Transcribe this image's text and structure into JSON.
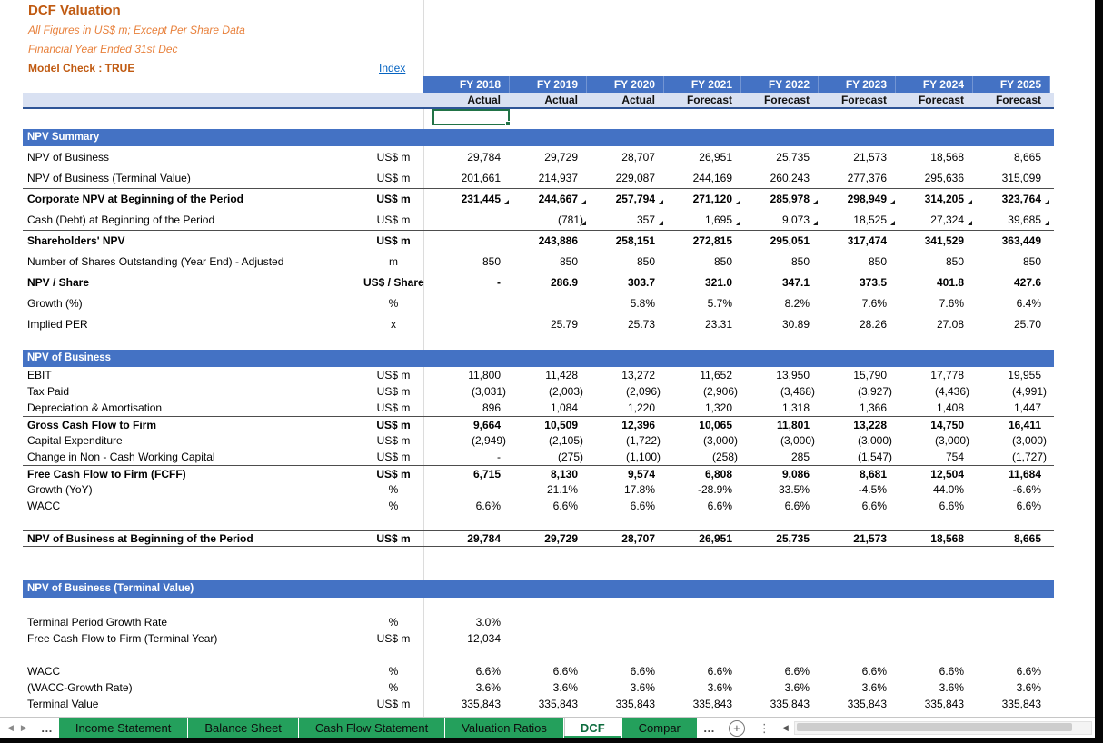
{
  "header": {
    "title": "DCF Valuation",
    "subtitle_units": "All Figures in US$ m; Except Per Share Data",
    "subtitle_fy": "Financial Year Ended 31st Dec",
    "model_check": "Model Check : TRUE",
    "index_link": "Index"
  },
  "columns": [
    {
      "year": "FY 2018",
      "type": "Actual"
    },
    {
      "year": "FY 2019",
      "type": "Actual"
    },
    {
      "year": "FY 2020",
      "type": "Actual"
    },
    {
      "year": "FY 2021",
      "type": "Forecast"
    },
    {
      "year": "FY 2022",
      "type": "Forecast"
    },
    {
      "year": "FY 2023",
      "type": "Forecast"
    },
    {
      "year": "FY 2024",
      "type": "Forecast"
    },
    {
      "year": "FY 2025",
      "type": "Forecast"
    }
  ],
  "selection": {
    "column": "FY 2018"
  },
  "sections": [
    {
      "header": "NPV Summary",
      "rows": [
        {
          "label": "NPV of Business",
          "unit": "US$ m",
          "values": [
            "29,784",
            "29,729",
            "28,707",
            "26,951",
            "25,735",
            "21,573",
            "18,568",
            "8,665"
          ]
        },
        {
          "label": "NPV of Business (Terminal Value)",
          "unit": "US$ m",
          "values": [
            "201,661",
            "214,937",
            "229,087",
            "244,169",
            "260,243",
            "277,376",
            "295,636",
            "315,099"
          ]
        },
        {
          "label": "Corporate NPV at Beginning of the Period",
          "unit": "US$ m",
          "bold": true,
          "border_top": true,
          "markers": true,
          "values": [
            "231,445",
            "244,667",
            "257,794",
            "271,120",
            "285,978",
            "298,949",
            "314,205",
            "323,764"
          ]
        },
        {
          "label": "Cash (Debt) at Beginning of the Period",
          "unit": "US$ m",
          "markers": true,
          "values": [
            "",
            "(781)",
            "357",
            "1,695",
            "9,073",
            "18,525",
            "27,324",
            "39,685"
          ]
        },
        {
          "label": "Shareholders' NPV",
          "unit": "US$ m",
          "bold": true,
          "border_top": true,
          "values": [
            "",
            "243,886",
            "258,151",
            "272,815",
            "295,051",
            "317,474",
            "341,529",
            "363,449"
          ]
        },
        {
          "label": "Number of Shares Outstanding (Year End) - Adjusted",
          "unit": "m",
          "values": [
            "850",
            "850",
            "850",
            "850",
            "850",
            "850",
            "850",
            "850"
          ]
        },
        {
          "label": "NPV / Share",
          "unit": "US$ / Share",
          "bold": true,
          "border_top": true,
          "values": [
            "-",
            "286.9",
            "303.7",
            "321.0",
            "347.1",
            "373.5",
            "401.8",
            "427.6"
          ]
        },
        {
          "label": "Growth (%)",
          "unit": "%",
          "values": [
            "",
            "",
            "5.8%",
            "5.7%",
            "8.2%",
            "7.6%",
            "7.6%",
            "6.4%"
          ]
        },
        {
          "label": "Implied PER",
          "unit": "x",
          "values": [
            "",
            "25.79",
            "25.73",
            "23.31",
            "30.89",
            "28.26",
            "27.08",
            "25.70"
          ]
        }
      ]
    },
    {
      "header": "NPV of Business",
      "rows": [
        {
          "label": "EBIT",
          "unit": "US$ m",
          "values": [
            "11,800",
            "11,428",
            "13,272",
            "11,652",
            "13,950",
            "15,790",
            "17,778",
            "19,955"
          ]
        },
        {
          "label": "Tax Paid",
          "unit": "US$ m",
          "values": [
            "(3,031)",
            "(2,003)",
            "(2,096)",
            "(2,906)",
            "(3,468)",
            "(3,927)",
            "(4,436)",
            "(4,991)"
          ]
        },
        {
          "label": "Depreciation & Amortisation",
          "unit": "US$ m",
          "values": [
            "896",
            "1,084",
            "1,220",
            "1,320",
            "1,318",
            "1,366",
            "1,408",
            "1,447"
          ]
        },
        {
          "label": "Gross Cash Flow to Firm",
          "unit": "US$ m",
          "bold": true,
          "border_top": true,
          "values": [
            "9,664",
            "10,509",
            "12,396",
            "10,065",
            "11,801",
            "13,228",
            "14,750",
            "16,411"
          ]
        },
        {
          "label": "Capital Expenditure",
          "unit": "US$ m",
          "values": [
            "(2,949)",
            "(2,105)",
            "(1,722)",
            "(3,000)",
            "(3,000)",
            "(3,000)",
            "(3,000)",
            "(3,000)"
          ]
        },
        {
          "label": "Change in Non - Cash Working Capital",
          "unit": "US$ m",
          "values": [
            "-",
            "(275)",
            "(1,100)",
            "(258)",
            "285",
            "(1,547)",
            "754",
            "(1,727)"
          ]
        },
        {
          "label": "Free Cash Flow to Firm (FCFF)",
          "unit": "US$ m",
          "bold": true,
          "border_top": true,
          "values": [
            "6,715",
            "8,130",
            "9,574",
            "6,808",
            "9,086",
            "8,681",
            "12,504",
            "11,684"
          ]
        },
        {
          "label": "Growth (YoY)",
          "unit": "%",
          "values": [
            "",
            "21.1%",
            "17.8%",
            "-28.9%",
            "33.5%",
            "-4.5%",
            "44.0%",
            "-6.6%"
          ]
        },
        {
          "label": "WACC",
          "unit": "%",
          "values": [
            "6.6%",
            "6.6%",
            "6.6%",
            "6.6%",
            "6.6%",
            "6.6%",
            "6.6%",
            "6.6%"
          ]
        },
        {
          "label": "",
          "unit": "",
          "values": [
            "",
            "",
            "",
            "",
            "",
            "",
            "",
            ""
          ]
        },
        {
          "label": "NPV of Business at Beginning of the Period",
          "unit": "US$ m",
          "bold": true,
          "border_top": true,
          "border_bottom": true,
          "values": [
            "29,784",
            "29,729",
            "28,707",
            "26,951",
            "25,735",
            "21,573",
            "18,568",
            "8,665"
          ]
        }
      ]
    },
    {
      "header": "NPV of Business (Terminal Value)",
      "rows": [
        {
          "label": "",
          "unit": "",
          "values": [
            "",
            "",
            "",
            "",
            "",
            "",
            "",
            ""
          ]
        },
        {
          "label": "Terminal Period Growth Rate",
          "unit": "%",
          "values": [
            "3.0%",
            "",
            "",
            "",
            "",
            "",
            "",
            ""
          ]
        },
        {
          "label": "Free Cash Flow to Firm (Terminal Year)",
          "unit": "US$ m",
          "values": [
            "12,034",
            "",
            "",
            "",
            "",
            "",
            "",
            ""
          ]
        },
        {
          "label": "",
          "unit": "",
          "values": [
            "",
            "",
            "",
            "",
            "",
            "",
            "",
            ""
          ]
        },
        {
          "label": "WACC",
          "unit": "%",
          "values": [
            "6.6%",
            "6.6%",
            "6.6%",
            "6.6%",
            "6.6%",
            "6.6%",
            "6.6%",
            "6.6%"
          ]
        },
        {
          "label": "(WACC-Growth Rate)",
          "unit": "%",
          "values": [
            "3.6%",
            "3.6%",
            "3.6%",
            "3.6%",
            "3.6%",
            "3.6%",
            "3.6%",
            "3.6%"
          ]
        },
        {
          "label": "Terminal Value",
          "unit": "US$ m",
          "values": [
            "335,843",
            "335,843",
            "335,843",
            "335,843",
            "335,843",
            "335,843",
            "335,843",
            "335,843"
          ]
        }
      ]
    }
  ],
  "sheet_tabs": {
    "nav_left": "◀",
    "nav_right": "▶",
    "overflow_left": "…",
    "overflow_right": "…",
    "tabs": [
      {
        "label": "Income Statement",
        "active": false
      },
      {
        "label": "Balance Sheet",
        "active": false
      },
      {
        "label": "Cash Flow Statement",
        "active": false
      },
      {
        "label": "Valuation Ratios",
        "active": false
      },
      {
        "label": "DCF",
        "active": true
      },
      {
        "label": "Compar",
        "active": false
      }
    ],
    "add_label": "+",
    "splitter": "⋮",
    "scroll_left": "◀"
  },
  "colors": {
    "header_blue": "#4472C4",
    "band_blue": "#D9E1F2",
    "band_border_navy": "#2F5597",
    "title_orange": "#C05A11",
    "subtitle_orange": "#E8803B",
    "link_blue": "#0563C1",
    "tab_green": "#24A05C",
    "selection_green": "#217346"
  }
}
